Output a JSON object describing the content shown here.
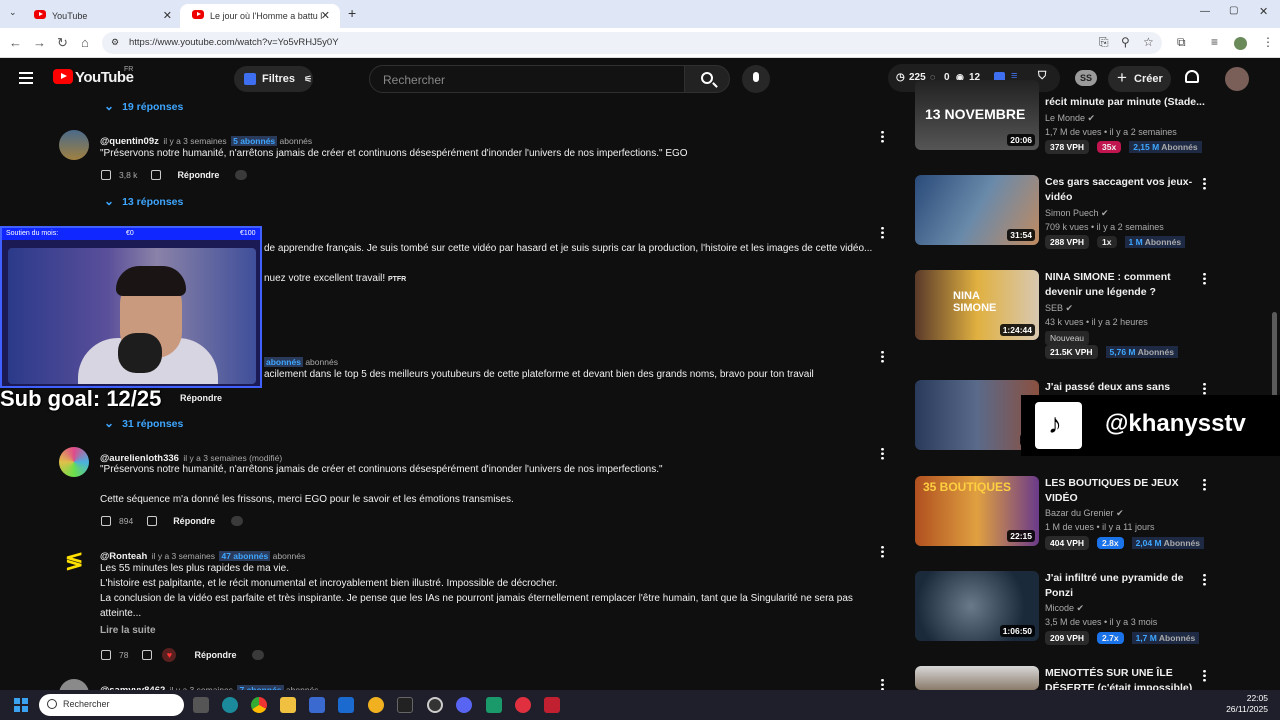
{
  "browser": {
    "tabs": [
      {
        "label": "YouTube"
      },
      {
        "label": "Le jour où l'Homme a battu la"
      }
    ],
    "url": "https://www.youtube.com/watch?v=Yo5vRHJ5y0Y"
  },
  "header": {
    "logo_text": "YouTube",
    "logo_region": "FR",
    "filtres_label": "Filtres",
    "search_placeholder": "Rechercher",
    "stats": {
      "time": "225",
      "eye": "0",
      "views": "12"
    },
    "ss_label": "SS",
    "create_label": "Créer"
  },
  "comments": [
    {
      "responses": "19 réponses"
    },
    {
      "username": "@quentin09z",
      "time": "il y a 3 semaines",
      "badge_num": "5 abonnés",
      "badge_text": "abonnés",
      "text": "\"Préservons notre humanité, n'arrêtons jamais de créer et continuons désespérément d'inonder l'univers de nos imperfections.\" EGO",
      "likes": "3,8 k",
      "reply": "Répondre",
      "responses": "13 réponses"
    },
    {
      "text1": "de apprendre français. Je suis tombé sur cette vidéo par hasard et je suis supris car la production, l'histoire et les images de cette vidéo...",
      "text2": "nuez votre excellent travail!",
      "tag": "PTFR"
    },
    {
      "badge_num": "abonnés",
      "badge_text": "abonnés",
      "text": "acilement dans le top 5 des meilleurs youtubeurs de cette plateforme et devant bien des grands noms, bravo pour ton travail",
      "reply": "Répondre",
      "responses": "31 réponses"
    },
    {
      "username": "@aurelienloth336",
      "time": "il y a 3 semaines (modifié)",
      "text1": "\"Préservons notre humanité, n'arrêtons jamais de créer et continuons désespérément d'inonder l'univers de nos imperfections.\"",
      "text2": "Cette séquence m'a donné les frissons, merci EGO pour le savoir et les émotions transmises.",
      "likes": "894",
      "reply": "Répondre"
    },
    {
      "username": "@Ronteah",
      "time": "il y a 3 semaines",
      "badge_num": "47 abonnés",
      "badge_text": "abonnés",
      "line1": "Les 55 minutes les plus rapides de ma vie.",
      "line2": "L'histoire est palpitante, et le récit monumental et incroyablement bien illustré. Impossible de décrocher.",
      "line3": "La conclusion de la vidéo est parfaite et très inspirante. Je pense que les IAs ne pourront jamais éternellement remplacer l'être humain, tant que la Singularité ne sera pas",
      "line4": "atteinte...",
      "more": "Lire la suite",
      "likes": "78",
      "reply": "Répondre"
    },
    {
      "username": "@samyvv8462",
      "time": "il y a 3 semaines",
      "badge_num": "7 abonnés",
      "badge_text": "abonnés"
    }
  ],
  "sidebar": [
    {
      "title": "récit minute par minute (Stade...",
      "channel": "Le Monde",
      "meta": "1,7 M de vues • il y a 2 semaines",
      "vph": "378 VPH",
      "mult": "35x",
      "mult_color": "#c0154e",
      "subs": "2,15 M",
      "subs_label": "Abonnés",
      "duration": "20:06",
      "thumb_text": "13 NOVEMBRE"
    },
    {
      "title": "Ces gars saccagent vos jeux-vidéo",
      "channel": "Simon Puech",
      "meta": "709 k vues • il y a 2 semaines",
      "vph": "288 VPH",
      "mult": "1x",
      "mult_color": "#272727",
      "subs": "1 M",
      "subs_label": "Abonnés",
      "duration": "31:54"
    },
    {
      "title": "NINA SIMONE : comment devenir une légende ?",
      "channel": "SEB",
      "meta": "43 k vues • il y a 2 heures",
      "nouveau": "Nouveau",
      "vph": "21.5K VPH",
      "subs": "5,76 M",
      "subs_label": "Abonnés",
      "duration": "1:24:44",
      "thumb_text": "NINA SIMONE"
    },
    {
      "title": "J'ai passé deux ans sans",
      "duration": "32"
    },
    {
      "title": "LES BOUTIQUES DE JEUX VIDÉO",
      "channel": "Bazar du Grenier",
      "meta": "1 M de vues • il y a 11 jours",
      "vph": "404 VPH",
      "mult": "2.8x",
      "mult_color": "#1a73e8",
      "subs": "2,04 M",
      "subs_label": "Abonnés",
      "duration": "22:15",
      "thumb_text": "35 BOUTIQUES"
    },
    {
      "title": "J'ai infiltré une pyramide de Ponzi",
      "channel": "Micode",
      "meta": "3,5 M de vues • il y a 3 mois",
      "vph": "209 VPH",
      "mult": "2.7x",
      "mult_color": "#1a73e8",
      "subs": "1,7 M",
      "subs_label": "Abonnés",
      "duration": "1:06:50"
    },
    {
      "title": "MENOTTÉS SUR UNE ÎLE DÉSERTE (c'était impossible)"
    }
  ],
  "overlays": {
    "soutien_label": "Soutien du mois:",
    "soutien_current": "€0",
    "soutien_goal": "€100",
    "sub_goal": "Sub goal: 12/25",
    "tiktok_handle": "@khanysstv"
  },
  "taskbar": {
    "search_placeholder": "Rechercher",
    "time": "22:05",
    "date": "26/11/2025"
  }
}
